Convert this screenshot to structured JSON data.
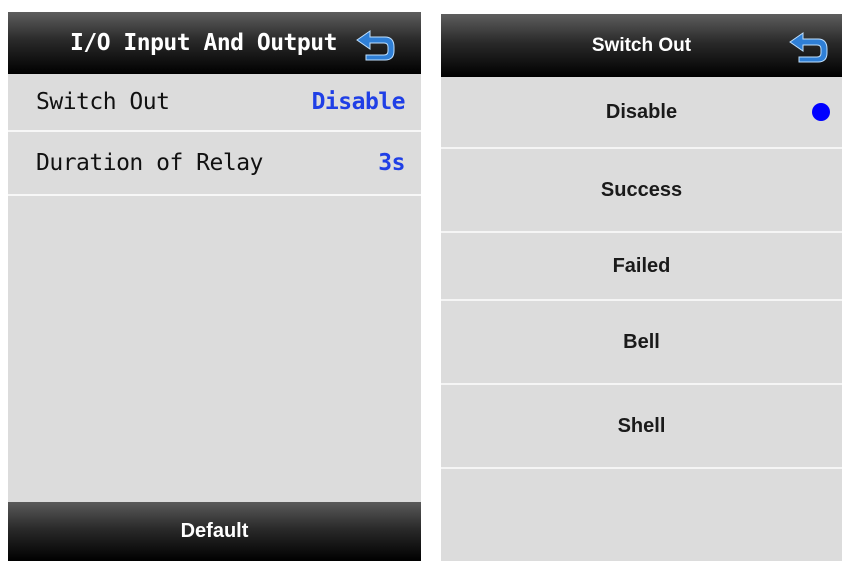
{
  "left_screen": {
    "title": "I/O Input And Output",
    "back_icon": "back-arrow-icon",
    "rows": [
      {
        "label": "Switch Out",
        "value": "Disable"
      },
      {
        "label": "Duration of Relay",
        "value": "3s"
      }
    ],
    "footer_button": "Default"
  },
  "right_screen": {
    "title": "Switch Out",
    "back_icon": "back-arrow-icon",
    "options": [
      {
        "label": "Disable",
        "selected": true
      },
      {
        "label": "Success",
        "selected": false
      },
      {
        "label": "Failed",
        "selected": false
      },
      {
        "label": "Bell",
        "selected": false
      },
      {
        "label": "Shell",
        "selected": false
      }
    ]
  },
  "colors": {
    "value_text": "#1f3fe6",
    "radio_selected": "#0000ff",
    "back_icon": "#2f7fd6",
    "screen_bg": "#dcdcdc"
  }
}
